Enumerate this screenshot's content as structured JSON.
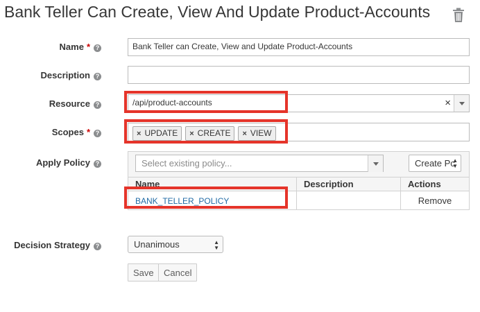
{
  "page": {
    "title": "Bank Teller Can Create, View And Update Product-Accounts",
    "icons": {
      "delete": "trash-icon",
      "help": "question-circle-icon"
    }
  },
  "form": {
    "name": {
      "label": "Name",
      "required_mark": "*",
      "value": "Bank Teller can Create, View and Update Product-Accounts"
    },
    "description": {
      "label": "Description",
      "value": ""
    },
    "resource": {
      "label": "Resource",
      "value": "/api/product-accounts",
      "clear": "×"
    },
    "scopes": {
      "label": "Scopes",
      "required_mark": "*",
      "chip_remove": "×",
      "items": [
        "UPDATE",
        "CREATE",
        "VIEW"
      ]
    },
    "apply_policy": {
      "label": "Apply Policy",
      "placeholder": "Select existing policy...",
      "create_label": "Create Pc",
      "table": {
        "headers": [
          "Name",
          "Description",
          "Actions"
        ],
        "rows": [
          {
            "name": "BANK_TELLER_POLICY",
            "description": "",
            "action": "Remove"
          }
        ]
      }
    },
    "decision_strategy": {
      "label": "Decision Strategy",
      "value": "Unanimous"
    },
    "buttons": {
      "save": "Save",
      "cancel": "Cancel"
    }
  },
  "colors": {
    "highlight": "#e5342a",
    "link": "#1f6aa5",
    "required": "#cc0000"
  }
}
